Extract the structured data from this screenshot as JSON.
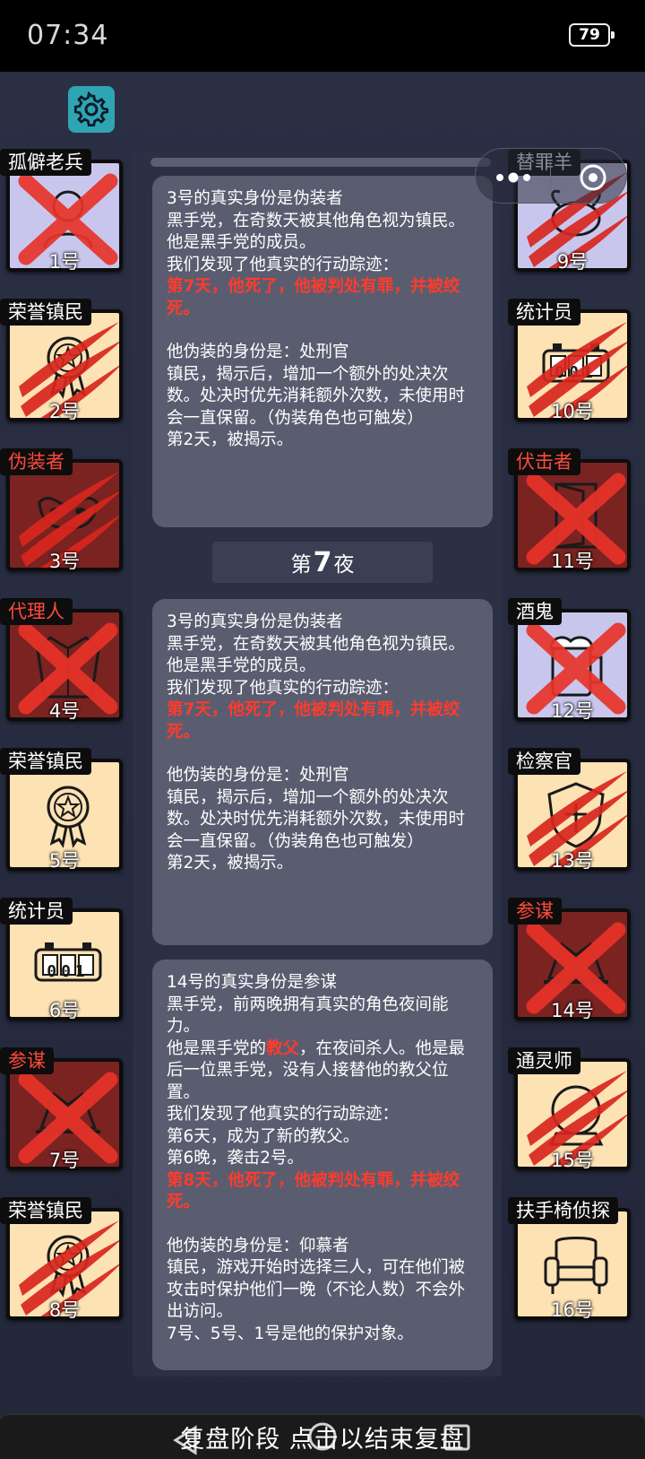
{
  "status_bar": {
    "time": "07:34",
    "battery": "79"
  },
  "players_left": [
    {
      "role": "孤僻老兵",
      "seat": "1号",
      "bg": "lav",
      "mark": "x",
      "icon": "soldier-icon",
      "role_red": false
    },
    {
      "role": "荣誉镇民",
      "seat": "2号",
      "bg": "cream",
      "mark": "claw",
      "icon": "medal-icon",
      "role_red": false
    },
    {
      "role": "伪装者",
      "seat": "3号",
      "bg": "maroon",
      "mark": "claw",
      "icon": "mask-icon",
      "role_red": true
    },
    {
      "role": "代理人",
      "seat": "4号",
      "bg": "maroon",
      "mark": "x",
      "icon": "coat-icon",
      "role_red": true
    },
    {
      "role": "荣誉镇民",
      "seat": "5号",
      "bg": "cream",
      "mark": "none",
      "icon": "medal-icon",
      "role_red": false
    },
    {
      "role": "统计员",
      "seat": "6号",
      "bg": "cream",
      "mark": "none",
      "icon": "counter-icon",
      "role_red": false,
      "counter": "001"
    },
    {
      "role": "参谋",
      "seat": "7号",
      "bg": "maroon",
      "mark": "x",
      "icon": "hat-icon",
      "role_red": true
    },
    {
      "role": "荣誉镇民",
      "seat": "8号",
      "bg": "cream",
      "mark": "claw",
      "icon": "medal-icon",
      "role_red": false
    }
  ],
  "players_right": [
    {
      "role": "替罪羊",
      "seat": "9号",
      "bg": "lav",
      "mark": "claw",
      "icon": "goat-icon",
      "role_red": false
    },
    {
      "role": "统计员",
      "seat": "10号",
      "bg": "cream",
      "mark": "claw",
      "icon": "counter-icon",
      "role_red": false,
      "counter": "001"
    },
    {
      "role": "伏击者",
      "seat": "11号",
      "bg": "maroon",
      "mark": "x",
      "icon": "door-icon",
      "role_red": true
    },
    {
      "role": "酒鬼",
      "seat": "12号",
      "bg": "lav",
      "mark": "x",
      "icon": "beer-icon",
      "role_red": false
    },
    {
      "role": "检察官",
      "seat": "13号",
      "bg": "cream",
      "mark": "claw",
      "icon": "badge-icon",
      "role_red": false
    },
    {
      "role": "参谋",
      "seat": "14号",
      "bg": "maroon",
      "mark": "x",
      "icon": "hat-icon",
      "role_red": true
    },
    {
      "role": "通灵师",
      "seat": "15号",
      "bg": "cream",
      "mark": "claw",
      "icon": "crystal-ball-icon",
      "role_red": false
    },
    {
      "role": "扶手椅侦探",
      "seat": "16号",
      "bg": "cream",
      "mark": "none",
      "icon": "armchair-icon",
      "role_red": false
    }
  ],
  "log": {
    "msg1": {
      "l1": "3号的真实身份是伪装者",
      "l2": "黑手党，在奇数天被其他角色视为镇民。",
      "l3": "他是黑手党的成员。",
      "l4": "我们发现了他真实的行动踪迹：",
      "l5": "第7天，他死了，他被判处有罪，并被绞死。",
      "l6": "他伪装的身份是：处刑官",
      "l7": "镇民，揭示后，增加一个额外的处决次数。处决时优先消耗额外次数，未使用时会一直保留。（伪装角色也可触发）",
      "l8": "第2天，被揭示。"
    },
    "night_prefix": "第",
    "night_number": "7",
    "night_suffix": "夜",
    "msg2": {
      "l1": "3号的真实身份是伪装者",
      "l2": "黑手党，在奇数天被其他角色视为镇民。",
      "l3": "他是黑手党的成员。",
      "l4": "我们发现了他真实的行动踪迹：",
      "l5": "第7天，他死了，他被判处有罪，并被绞死。",
      "l6": "他伪装的身份是：处刑官",
      "l7": "镇民，揭示后，增加一个额外的处决次数。处决时优先消耗额外次数，未使用时会一直保留。（伪装角色也可触发）",
      "l8": "第2天，被揭示。"
    },
    "msg3": {
      "l1": "14号的真实身份是参谋",
      "l2": "黑手党，前两晚拥有真实的角色夜间能力。",
      "l3a": "他是黑手党的",
      "l3b": "教父",
      "l3c": "，在夜间杀人。他是最后一位黑手党，没有人接替他的教父位置。",
      "l4": "我们发现了他真实的行动踪迹：",
      "l5": "第6天，成为了新的教父。",
      "l6": "第6晚，袭击2号。",
      "l7": "第8天，他死了，他被判处有罪，并被绞死。",
      "l8": "他伪装的身份是：仰慕者",
      "l9": "镇民，游戏开始时选择三人，可在他们被攻击时保护他们一晚（不论人数）不会外出访问。",
      "l10": "7号、5号、1号是他的保护对象。"
    }
  },
  "bottom_bar": {
    "label": "复盘阶段 点击以结束复盘"
  },
  "colors": {
    "accent_red": "#ff3b2c",
    "teal": "#2fa5b3",
    "cream": "#fde2b4",
    "lavender": "#c9c6ee",
    "maroon": "#7a2321"
  }
}
